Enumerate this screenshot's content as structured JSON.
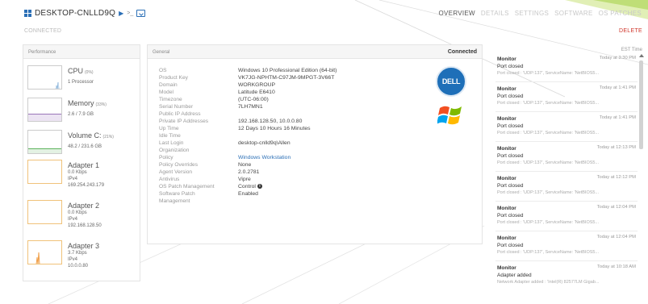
{
  "header": {
    "hostname": "DESKTOP-CNLLD9Q",
    "arrow": "▶",
    "prompt": ">_",
    "tabs": [
      "OVERVIEW",
      "DETAILS",
      "SETTINGS",
      "SOFTWARE",
      "OS PATCHES"
    ]
  },
  "status": {
    "connected": "CONNECTED",
    "delete": "DELETE",
    "timezone": "EST Time"
  },
  "performance": {
    "title": "Performance",
    "cpu": {
      "name": "CPU",
      "pct": "(0%)",
      "line1": "1 Processor"
    },
    "memory": {
      "name": "Memory",
      "pct": "(33%)",
      "line1": "2.6 / 7.9 GB",
      "level": 0.33
    },
    "volume": {
      "name": "Volume C:",
      "pct": "(21%)",
      "line1": "48.2 / 231.6 GB",
      "level": 0.21
    },
    "adapters": [
      {
        "name": "Adapter 1",
        "speed": "0.0 Kbps",
        "proto": "IPv4",
        "ip": "169.254.243.179"
      },
      {
        "name": "Adapter 2",
        "speed": "0.0 Kbps",
        "proto": "IPv4",
        "ip": "192.168.128.50"
      },
      {
        "name": "Adapter 3",
        "speed": "3.7 Kbps",
        "proto": "IPv4",
        "ip": "10.0.0.80"
      }
    ]
  },
  "general": {
    "title": "General",
    "connection": "Connected",
    "rows": [
      {
        "k": "OS",
        "v": "Windows 10 Professional Edition (64-bit)"
      },
      {
        "k": "Product Key",
        "v": "VK7JG-NPHTM-C97JM-9MPGT-3V66T"
      },
      {
        "k": "Domain",
        "v": "WORKGROUP"
      },
      {
        "k": "Model",
        "v": "Latitude E6410"
      },
      {
        "k": "Timezone",
        "v": "(UTC-06:00)"
      },
      {
        "k": "Serial Number",
        "v": "7LH7MN1"
      },
      {
        "k": "Public IP Address",
        "v": ""
      },
      {
        "k": "Private IP Addresses",
        "v": "192.168.128.50, 10.0.0.80"
      },
      {
        "k": "Up Time",
        "v": "12 Days 10 Hours 16 Minutes"
      },
      {
        "k": "Idle Time",
        "v": ""
      },
      {
        "k": "Last Login",
        "v": "desktop-cnlld9q\\Allen"
      },
      {
        "k": "Organization",
        "v": ""
      },
      {
        "k": "Policy",
        "v": "Windows Workstation"
      },
      {
        "k": "Policy Overrides",
        "v": "None"
      },
      {
        "k": "Agent Version",
        "v": "2.0.2781"
      },
      {
        "k": "Antivirus",
        "v": "Vipre"
      },
      {
        "k": "OS Patch Management",
        "v": "Control"
      },
      {
        "k": "Software Patch",
        "v": "Enabled"
      },
      {
        "k": "Management",
        "v": ""
      }
    ],
    "dell_logo": "DELL",
    "windows_logo_icon": "windows-flag-icon"
  },
  "events": [
    {
      "src": "Monitor",
      "time": "Today at 3:30 PM",
      "msg": "Port closed",
      "detail": "Port closed : 'UDP:137', ServiceName: 'NetBIOS5..."
    },
    {
      "src": "Monitor",
      "time": "Today at 1:41 PM",
      "msg": "Port closed",
      "detail": "Port closed : 'UDP:137', ServiceName: 'NetBIOS5..."
    },
    {
      "src": "Monitor",
      "time": "Today at 1:41 PM",
      "msg": "Port closed",
      "detail": "Port closed : 'UDP:137', ServiceName: 'NetBIOS5..."
    },
    {
      "src": "Monitor",
      "time": "Today at 12:13 PM",
      "msg": "Port closed",
      "detail": "Port closed : 'UDP:137', ServiceName: 'NetBIOS5..."
    },
    {
      "src": "Monitor",
      "time": "Today at 12:12 PM",
      "msg": "Port closed",
      "detail": "Port closed : 'UDP:137', ServiceName: 'NetBIOS5..."
    },
    {
      "src": "Monitor",
      "time": "Today at 12:04 PM",
      "msg": "Port closed",
      "detail": "Port closed : 'UDP:137', ServiceName: 'NetBIOS5..."
    },
    {
      "src": "Monitor",
      "time": "Today at 12:04 PM",
      "msg": "Port closed",
      "detail": "Port closed : 'UDP:137', ServiceName: 'NetBIOS5..."
    },
    {
      "src": "Monitor",
      "time": "Today at 10:18 AM",
      "msg": "Adapter added",
      "detail": "Network Adapter added : 'Intel(R) 82577LM Gigab..."
    }
  ],
  "colors": {
    "accent": "#2b6fb6",
    "danger": "#d0362b",
    "cpu": "#8db6db",
    "memory": "#9a76b9",
    "volume": "#5cb35c",
    "adapter": "#f0c27a"
  }
}
